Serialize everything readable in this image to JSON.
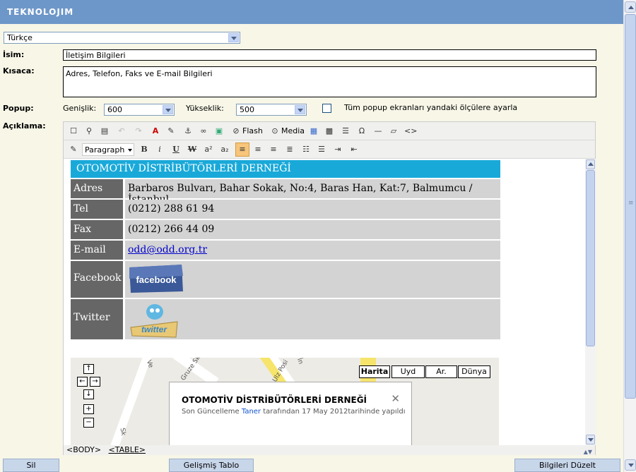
{
  "app": {
    "logo": "TEKNOLOJIM"
  },
  "language_select": {
    "value": "Türkçe"
  },
  "form": {
    "name_label": "İsim:",
    "name_value": "İletişim Bilgileri",
    "short_label": "Kısaca:",
    "short_value": "Adres, Telefon, Faks ve E-mail Bilgileri",
    "popup_label": "Popup:",
    "width_label": "Genişlik:",
    "width_value": "600",
    "height_label": "Yükseklik:",
    "height_value": "500",
    "checkbox_label": "Tüm popup ekranları yandaki ölçülere ayarla",
    "desc_label": "Açıklama:"
  },
  "toolbar": {
    "flash": "Flash",
    "media": "Media",
    "format": "Paragraph",
    "superscript": "a²",
    "subscript": "a₂",
    "omega": "Ω",
    "source": "<>"
  },
  "content": {
    "header": "OTOMOTİV DİSTRİBÜTÖRLERİ DERNEĞİ",
    "rows": [
      {
        "label": "Adres",
        "value": "Barbaros Bulvarı, Bahar Sokak, No:4, Baras Han, Kat:7, Balmumcu / İstanbul"
      },
      {
        "label": "Tel",
        "value": "(0212) 288 61 94"
      },
      {
        "label": "Fax",
        "value": "(0212) 266 44 09"
      },
      {
        "label": "E-mail",
        "value": "odd@odd.org.tr"
      },
      {
        "label": "Facebook",
        "value": "facebook"
      },
      {
        "label": "Twitter",
        "value": "twitter"
      }
    ]
  },
  "map": {
    "types": [
      "Harita",
      "Uyd",
      "Ar.",
      "Dünya"
    ],
    "selected": "Harita",
    "info_title": "OTOMOTİV DİSTRİBÜTÖRLERİ DERNEĞİ",
    "info_pre": "Son Güncelleme",
    "info_user": "Taner",
    "info_post": "tarafından 17 May 2012tarihinde yapıldı",
    "streets": [
      "Ve",
      "Gruze Sk",
      "Ulz Posi",
      "Sk",
      "İn"
    ]
  },
  "statusbar": {
    "path": [
      "<BODY>",
      "<TABLE>"
    ]
  },
  "buttons": {
    "delete": "Sil",
    "advanced_table": "Gelişmiş Tablo",
    "save": "Bilgileri Düzelt"
  }
}
